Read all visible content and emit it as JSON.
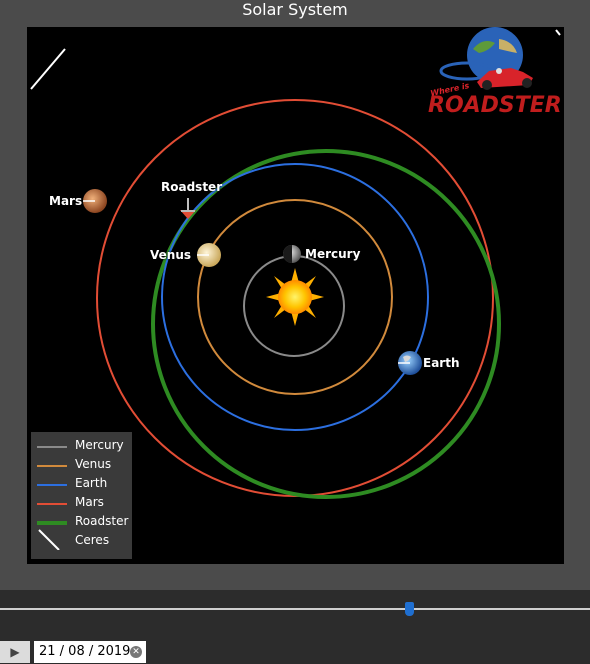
{
  "app": {
    "title": "Solar System"
  },
  "planets": {
    "mercury": "Mercury",
    "venus": "Venus",
    "earth": "Earth",
    "mars": "Mars",
    "roadster": "Roadster"
  },
  "legend": [
    {
      "label": "Mercury",
      "color": "#8a8a8a"
    },
    {
      "label": "Venus",
      "color": "#d18a3c"
    },
    {
      "label": "Earth",
      "color": "#2c6fe0"
    },
    {
      "label": "Mars",
      "color": "#e24d35"
    },
    {
      "label": "Roadster",
      "color": "#2e8b22"
    },
    {
      "label": "Ceres",
      "color": "#ffffff"
    }
  ],
  "logo": {
    "line1": "Where is",
    "line2": "ROADSTER?"
  },
  "controls": {
    "date": "21 / 08 / 2019",
    "play_icon": "play-icon",
    "clear_icon": "clear-icon",
    "timeline_position": 0.69
  }
}
